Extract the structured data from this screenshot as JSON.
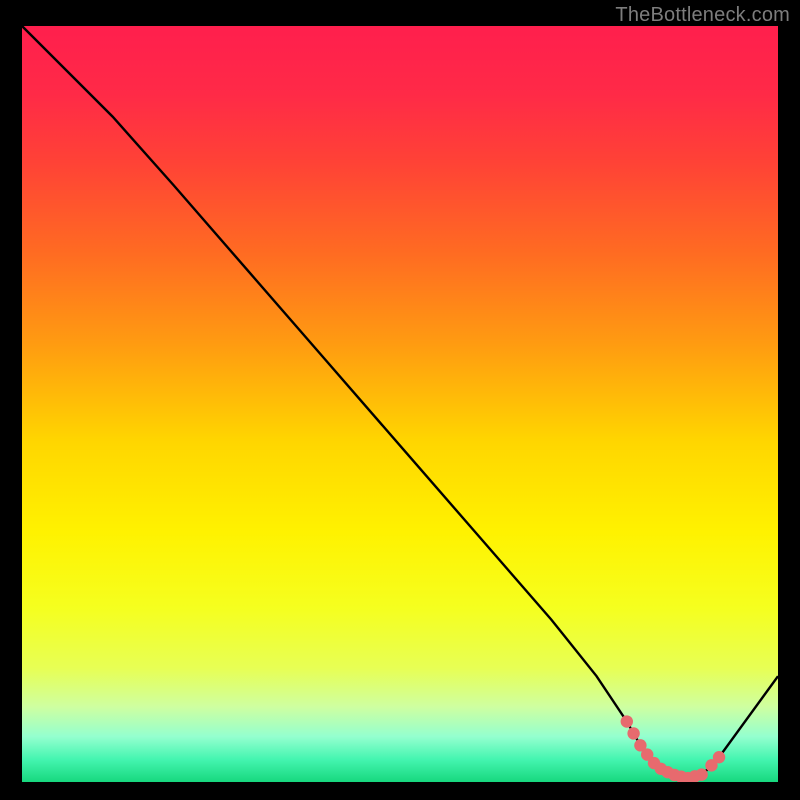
{
  "attribution": "TheBottleneck.com",
  "colors": {
    "background": "#000000",
    "attribution_text": "#7d7d7d",
    "curve": "#000000",
    "marker_fill": "#e76a6e",
    "marker_stroke": "#c94a4f",
    "gradient_stops": [
      {
        "offset": 0.0,
        "color": "#ff1f4d"
      },
      {
        "offset": 0.09,
        "color": "#ff2a47"
      },
      {
        "offset": 0.18,
        "color": "#ff4236"
      },
      {
        "offset": 0.3,
        "color": "#ff6b22"
      },
      {
        "offset": 0.42,
        "color": "#ff9b11"
      },
      {
        "offset": 0.55,
        "color": "#ffd600"
      },
      {
        "offset": 0.67,
        "color": "#fff200"
      },
      {
        "offset": 0.77,
        "color": "#f5ff1f"
      },
      {
        "offset": 0.85,
        "color": "#e7ff55"
      },
      {
        "offset": 0.9,
        "color": "#cfffa0"
      },
      {
        "offset": 0.94,
        "color": "#94ffcf"
      },
      {
        "offset": 0.97,
        "color": "#44f5b0"
      },
      {
        "offset": 1.0,
        "color": "#17d87e"
      }
    ]
  },
  "chart_data": {
    "type": "line",
    "xlim": [
      0,
      100
    ],
    "ylim": [
      0,
      100
    ],
    "x": [
      0,
      6,
      12,
      20,
      30,
      40,
      50,
      60,
      70,
      76,
      80,
      82,
      84,
      86,
      88,
      90,
      92,
      100
    ],
    "values": [
      100,
      94,
      88,
      79,
      67.5,
      56,
      44.5,
      33,
      21.5,
      14,
      8,
      4.5,
      2,
      1,
      0.5,
      1,
      3,
      14
    ],
    "highlight_x_range": [
      80,
      92
    ],
    "title": "",
    "xlabel": "",
    "ylabel": ""
  }
}
